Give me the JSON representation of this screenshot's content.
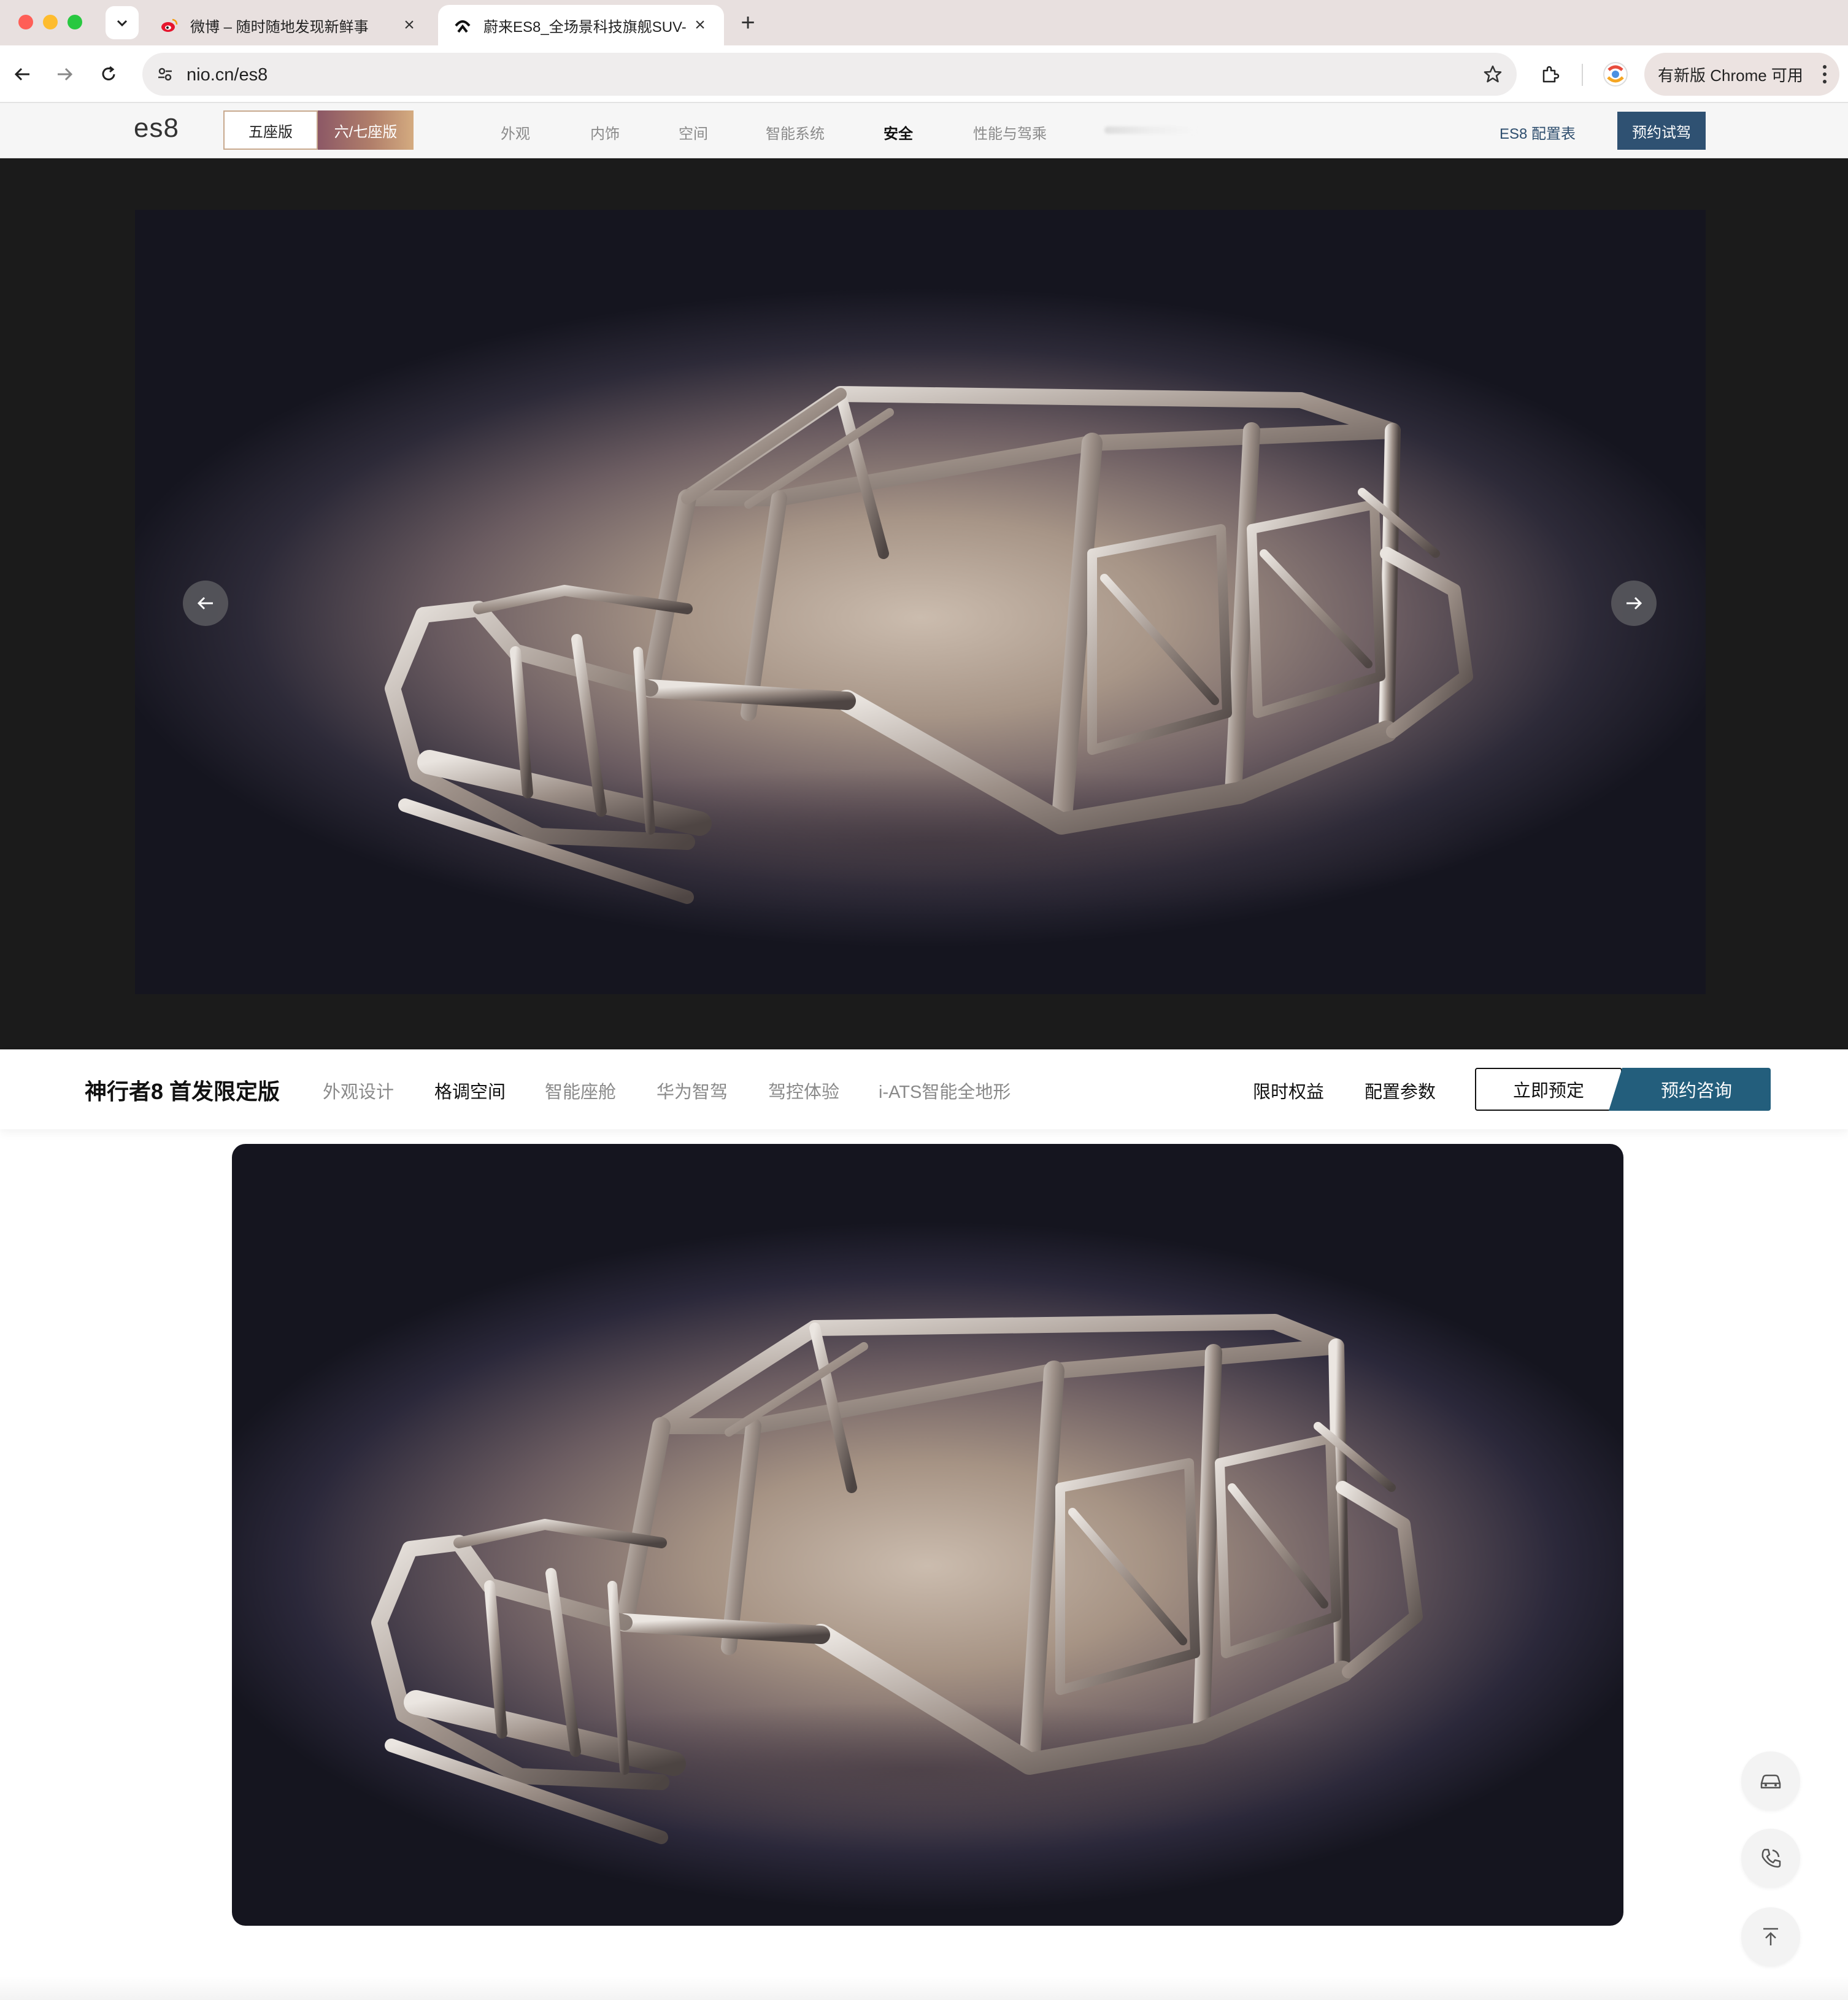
{
  "browser": {
    "tabs": [
      {
        "title": "微博 – 随时随地发现新鲜事",
        "favicon": "weibo-icon",
        "active": false
      },
      {
        "title": "蔚来ES8_全场景科技旗舰SUV-",
        "favicon": "nio-icon",
        "active": true
      }
    ],
    "url": "nio.cn/es8",
    "update_label": "有新版 Chrome 可用"
  },
  "site_nav": {
    "brand": "es8",
    "seat_options": [
      {
        "label": "五座版",
        "selected": true
      },
      {
        "label": "六/七座版",
        "selected": false
      }
    ],
    "links": [
      {
        "label": "外观",
        "active": false
      },
      {
        "label": "内饰",
        "active": false
      },
      {
        "label": "空间",
        "active": false
      },
      {
        "label": "智能系统",
        "active": false
      },
      {
        "label": "安全",
        "active": true
      },
      {
        "label": "性能与驾乘",
        "active": false
      }
    ],
    "config_label": "ES8 配置表",
    "test_drive_label": "预约试驾"
  },
  "hero": {
    "prev_icon": "arrow-left-icon",
    "next_icon": "arrow-right-icon"
  },
  "sub_nav": {
    "title": "神行者8 首发限定版",
    "links": [
      {
        "label": "外观设计",
        "active": false
      },
      {
        "label": "格调空间",
        "active": true
      },
      {
        "label": "智能座舱",
        "active": false
      },
      {
        "label": "华为智驾",
        "active": false
      },
      {
        "label": "驾控体验",
        "active": false
      },
      {
        "label": "i-ATS智能全地形",
        "active": false
      }
    ],
    "benefits_label": "限时权益",
    "params_label": "配置参数",
    "order_label": "立即预定",
    "consult_label": "预约咨询"
  },
  "floating": {
    "icons": [
      "car-icon",
      "phone-icon",
      "back-to-top-icon"
    ]
  },
  "colors": {
    "accent_blue": "#2f5172",
    "consult_teal": "#235e7c",
    "hero_bg": "#1b1b1b"
  }
}
